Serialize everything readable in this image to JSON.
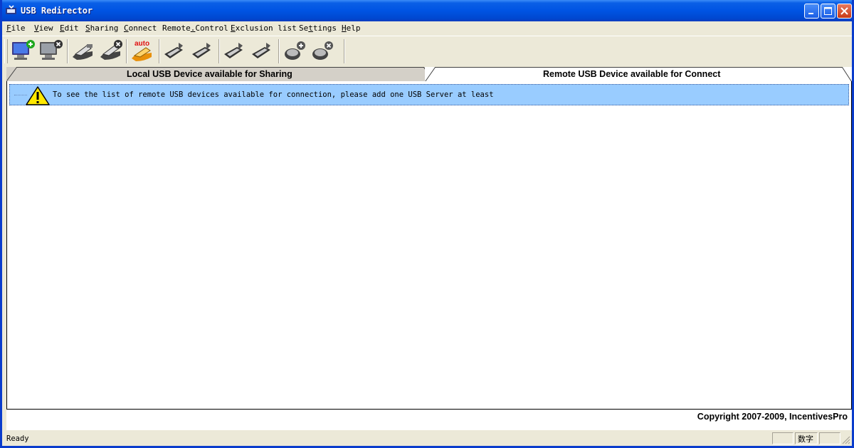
{
  "window": {
    "title": "USB Redirector",
    "icon": "usb-redirector-app-icon",
    "buttons": [
      "minimize",
      "maximize",
      "close"
    ]
  },
  "menu": {
    "file": {
      "hotkey": "F",
      "rest": "ile"
    },
    "view": {
      "hotkey": "V",
      "rest": "iew"
    },
    "edit": {
      "hotkey": "E",
      "rest": "dit"
    },
    "sharing": {
      "hotkey": "S",
      "rest": "haring"
    },
    "connect": {
      "hotkey": "C",
      "rest": "onnect"
    },
    "remote_control": {
      "pre": "Remote",
      "hotkey": ".",
      "rest": "Control"
    },
    "exclusion_list": {
      "hotkey": "E",
      "rest": "xclusion list"
    },
    "settings": {
      "pre": "Se",
      "hotkey": "t",
      "rest": "tings"
    },
    "help": {
      "hotkey": "H",
      "rest": "elp"
    }
  },
  "toolbar": {
    "auto_label": "auto",
    "icons": [
      "add-server-icon",
      "remove-server-icon",
      "share-device-icon",
      "unshare-device-icon",
      "auto-share-icon",
      "connect-device-icon",
      "connect-device-alt-icon",
      "disconnect-device-icon",
      "disconnect-device-alt-icon",
      "add-exclusion-icon",
      "remove-exclusion-icon"
    ]
  },
  "tabs": {
    "local": "Local USB Device available for Sharing",
    "remote": "Remote USB Device available for Connect",
    "active": "remote"
  },
  "notice": {
    "icon": "warning-icon",
    "text": "To see the list of remote USB devices available for connection, please add one USB Server at least"
  },
  "copyright": "Copyright 2007-2009, IncentivesPro",
  "status": {
    "text": "Ready",
    "panes": [
      "",
      "数字",
      ""
    ]
  },
  "colors": {
    "titlebar": "#0054e3",
    "notice_bg": "#99ccff",
    "chrome": "#ece9d8"
  }
}
